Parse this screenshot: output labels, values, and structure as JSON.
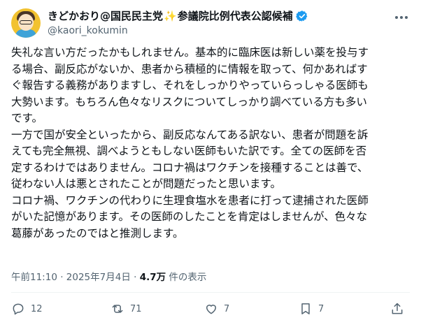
{
  "user": {
    "name_part1": "きどかおり@国民民主党",
    "sparkle": "✨",
    "name_part2": "参議院比例代表公認候補",
    "handle": "@kaori_kokumin"
  },
  "tweet": {
    "lines": [
      "失礼な言い方だったかもしれません。基本的に臨床医は新しい薬を投与す",
      "る場合、副反応がないか、患者から積極的に情報を取って、何かあればす",
      "ぐ報告する義務がありますし、それをしっかりやっていらっしゃる医師も",
      "大勢います。もちろん色々なリスクについてしっかり調べている方も多い",
      "です。",
      "一方で国が安全といったから、副反応なんてある訳ない、患者が問題を訴",
      "えても完全無視、調べようともしない医師もいた訳です。全ての医師を否",
      "定するわけではありません。コロナ禍はワクチンを接種することは善で、",
      "従わない人は悪とされたことが問題だったと思います。",
      "コロナ禍、ワクチンの代わりに生理食塩水を患者に打って逮捕された医師",
      "がいた記憶があります。その医師のしたことを肯定はしませんが、色々な",
      "葛藤があったのではと推測します。"
    ]
  },
  "meta": {
    "time": "午前11:10 · 2025年7月4日 · ",
    "views_count": "4.7万",
    "views_label": " 件の表示"
  },
  "actions": {
    "reply_count": "12",
    "retweet_count": "71",
    "like_count": "7",
    "bookmark_count": "7"
  },
  "colors": {
    "text": "#0f1419",
    "secondary": "#536471",
    "verified": "#1d9bf0",
    "divider": "#eff3f4"
  },
  "icons": [
    "verified-badge-icon",
    "more-icon",
    "reply-icon",
    "retweet-icon",
    "like-icon",
    "bookmark-icon",
    "share-icon"
  ]
}
